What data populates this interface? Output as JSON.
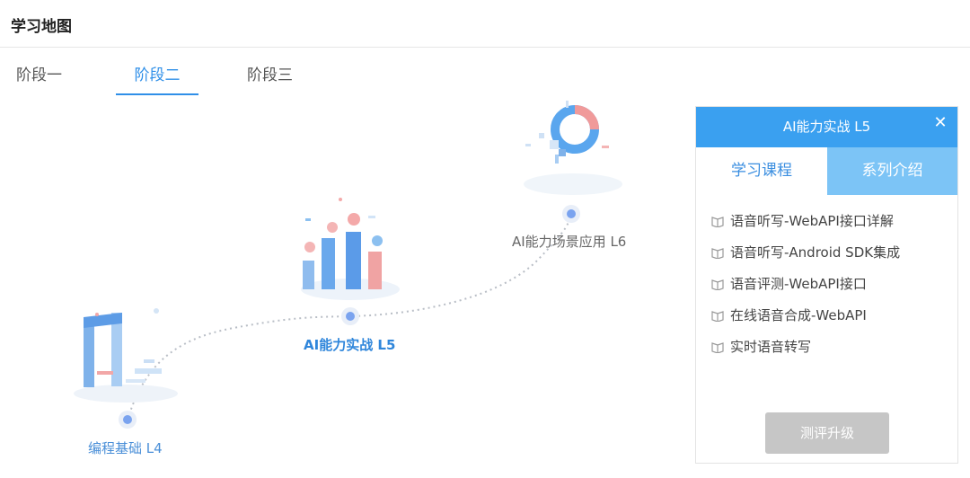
{
  "header": {
    "title": "学习地图"
  },
  "tabs": [
    {
      "label": "阶段一"
    },
    {
      "label": "阶段二"
    },
    {
      "label": "阶段三"
    }
  ],
  "map": {
    "nodes": [
      {
        "label": "编程基础 L4"
      },
      {
        "label": "AI能力实战 L5"
      },
      {
        "label": "AI能力场景应用 L6"
      }
    ]
  },
  "panel": {
    "title": "AI能力实战 L5",
    "close_icon": "close-icon",
    "tabs": [
      {
        "label": "学习课程"
      },
      {
        "label": "系列介绍"
      }
    ],
    "courses": [
      {
        "label": "语音听写-WebAPI接口详解"
      },
      {
        "label": "语音听写-Android SDK集成"
      },
      {
        "label": "语音评测-WebAPI接口"
      },
      {
        "label": "在线语音合成-WebAPI"
      },
      {
        "label": "实时语音转写"
      }
    ],
    "upgrade_label": "测评升级"
  },
  "colors": {
    "accent": "#2f8fe8",
    "panel_header": "#3aa0f0",
    "active_tab_bg": "#7cc4f6",
    "disabled_button": "#c6c6c6"
  }
}
